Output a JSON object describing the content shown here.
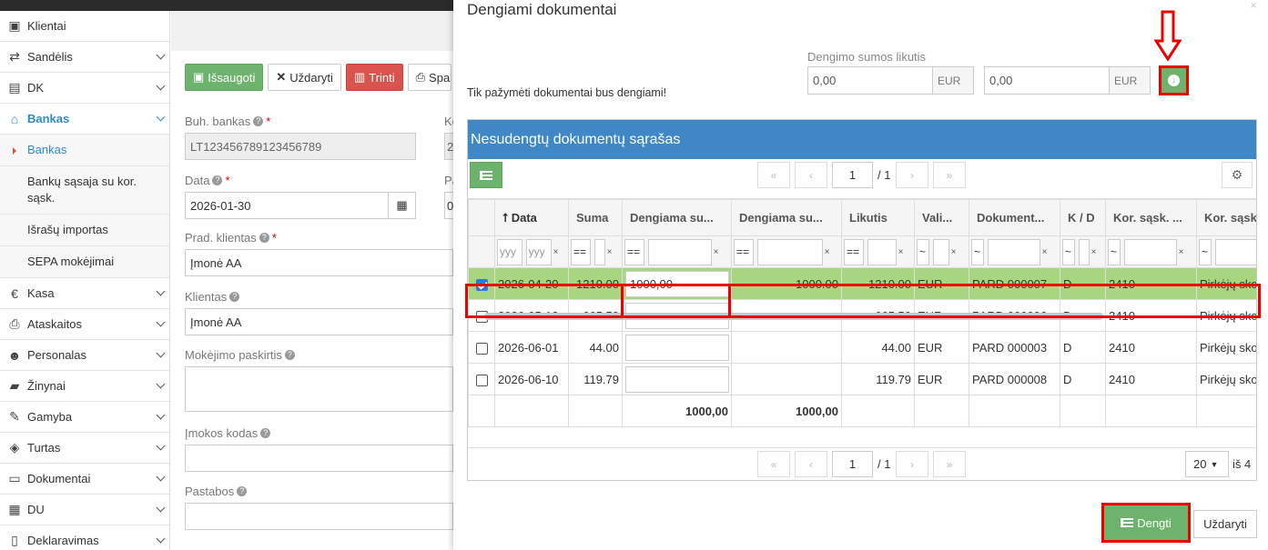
{
  "sidebar": {
    "items": [
      {
        "label": "Klientai",
        "icon": "user-card-icon"
      },
      {
        "label": "Sandėlis",
        "icon": "exchange-icon"
      },
      {
        "label": "DK",
        "icon": "book-icon"
      },
      {
        "label": "Bankas",
        "icon": "bank-icon"
      },
      {
        "label": "Kasa",
        "icon": "euro-icon"
      },
      {
        "label": "Ataskaitos",
        "icon": "print-icon"
      },
      {
        "label": "Personalas",
        "icon": "users-icon"
      },
      {
        "label": "Žinynai",
        "icon": "folder-open-icon"
      },
      {
        "label": "Gamyba",
        "icon": "wrench-icon"
      },
      {
        "label": "Turtas",
        "icon": "cube-icon"
      },
      {
        "label": "Dokumentai",
        "icon": "inbox-icon"
      },
      {
        "label": "DU",
        "icon": "table-icon"
      },
      {
        "label": "Deklaravimas",
        "icon": "file-icon"
      }
    ],
    "bank_sub": [
      "Bankas",
      "Bankų sąsaja su kor. sąsk.",
      "Išrašų importas",
      "SEPA mokėjimai"
    ]
  },
  "form": {
    "buttons": {
      "save": "Išsaugoti",
      "close": "Uždaryti",
      "delete": "Trinti",
      "print": "Spa"
    },
    "buh_bankas_label": "Buh. bankas",
    "buh_bankas_value": "LT123456789123456789",
    "data_label": "Data",
    "data_value": "2026-01-30",
    "prad_klientas_label": "Prad. klientas",
    "prad_klientas_value": "Įmonė AA",
    "klientas_label": "Klientas",
    "klientas_value": "Įmonė AA",
    "paskirtis_label": "Mokėjimo paskirtis",
    "imokos_label": "Įmokos kodas",
    "pastabos_label": "Pastabos",
    "cut_k": "Ko",
    "cut_2": "2",
    "cut_p": "Pa",
    "cut_0": "0"
  },
  "modal": {
    "title": "Dengiami dokumentai",
    "close": "×",
    "info": "Tik pažymėti dokumentai bus dengiami!",
    "sum_label": "Dengimo sumos likutis",
    "sum1": "0,00",
    "sum2": "0,00",
    "currency": "EUR",
    "panel_title": "Nesudengtų dokumentų sąrašas",
    "pager": {
      "page": "1",
      "of": "/ 1",
      "first": "«",
      "prev": "‹",
      "next": "›",
      "last": "»"
    },
    "columns": [
      "Data",
      "Suma",
      "Dengiama su...",
      "Dengiama su...",
      "Likutis",
      "Vali...",
      "Dokument...",
      "K / D",
      "Kor. sąsk. ...",
      "Kor. sąsk"
    ],
    "rows": [
      {
        "data": "2026-04-20",
        "suma": "1210.00",
        "deng1": "1000,00",
        "deng2": "1000.00",
        "likutis": "1210.00",
        "val": "EUR",
        "dok": "PARD 000007",
        "kd": "D",
        "kor": "2410",
        "kor2": "Pirkėjų sko",
        "checked": true
      },
      {
        "data": "2026-05-12",
        "suma": "665.50",
        "deng1": "",
        "deng2": "",
        "likutis": "665.50",
        "val": "EUR",
        "dok": "PARD 000006",
        "kd": "D",
        "kor": "2410",
        "kor2": "Pirkėjų sko",
        "checked": false
      },
      {
        "data": "2026-06-01",
        "suma": "44.00",
        "deng1": "",
        "deng2": "",
        "likutis": "44.00",
        "val": "EUR",
        "dok": "PARD 000003",
        "kd": "D",
        "kor": "2410",
        "kor2": "Pirkėjų sko",
        "checked": false
      },
      {
        "data": "2026-06-10",
        "suma": "119.79",
        "deng1": "",
        "deng2": "",
        "likutis": "119.79",
        "val": "EUR",
        "dok": "PARD 000008",
        "kd": "D",
        "kor": "2410",
        "kor2": "Pirkėjų sko",
        "checked": false
      }
    ],
    "totals": {
      "deng1": "1000,00",
      "deng2": "1000,00"
    },
    "filters": {
      "date1": "yyy",
      "date2": "yyy",
      "eq": "==",
      "tilde": "~",
      "x": "×"
    },
    "page_size": "20",
    "of_total": "iš 4",
    "dengti": "Dengti",
    "uzdaryti": "Uždaryti"
  },
  "colors": {
    "green": "#6db36d",
    "blue_header": "#3f88c5",
    "highlight": "#e00000",
    "selected_row": "#a8d57f"
  }
}
